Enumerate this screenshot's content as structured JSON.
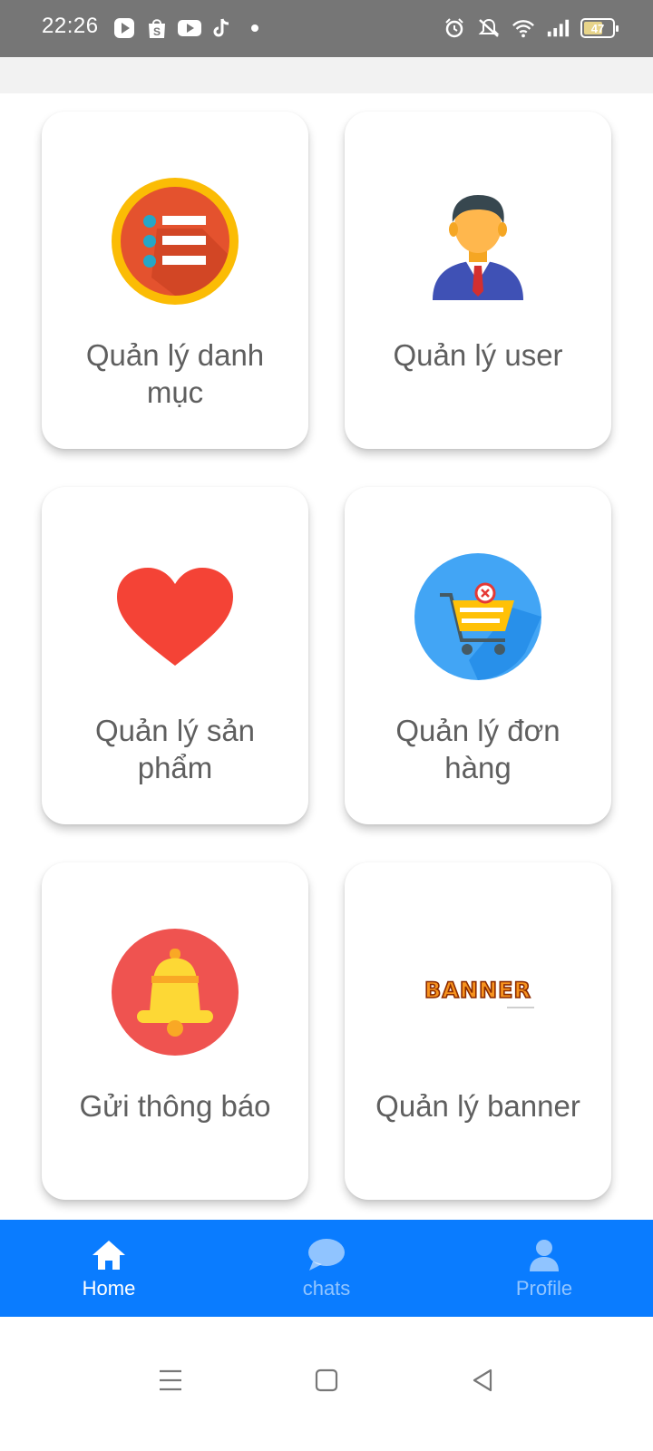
{
  "status_bar": {
    "time": "22:26",
    "battery": "47",
    "left_icons": [
      "play-icon",
      "shopee-icon",
      "youtube-icon",
      "tiktok-icon",
      "dot-icon"
    ],
    "right_icons": [
      "alarm-icon",
      "mute-icon",
      "wifi-icon",
      "signal-icon",
      "battery-icon"
    ]
  },
  "cards": [
    {
      "label": "Quản lý danh mục",
      "icon": "category-list-icon"
    },
    {
      "label": "Quản lý user",
      "icon": "user-avatar-icon"
    },
    {
      "label": "Quản lý sản phẩm",
      "icon": "heart-icon"
    },
    {
      "label": "Quản lý đơn hàng",
      "icon": "shopping-cart-icon"
    },
    {
      "label": "Gửi thông báo",
      "icon": "bell-icon"
    },
    {
      "label": "Quản lý banner",
      "icon": "banner-icon"
    }
  ],
  "banner_logo_text": "BANNER",
  "bottom_nav": {
    "items": [
      {
        "label": "Home",
        "icon": "home-icon",
        "active": true
      },
      {
        "label": "chats",
        "icon": "chat-bubble-icon",
        "active": false
      },
      {
        "label": "Profile",
        "icon": "person-icon",
        "active": false
      }
    ]
  },
  "colors": {
    "status_bar": "#767676",
    "nav_bar": "#0a7cff",
    "label_text": "#5f5f5f"
  }
}
